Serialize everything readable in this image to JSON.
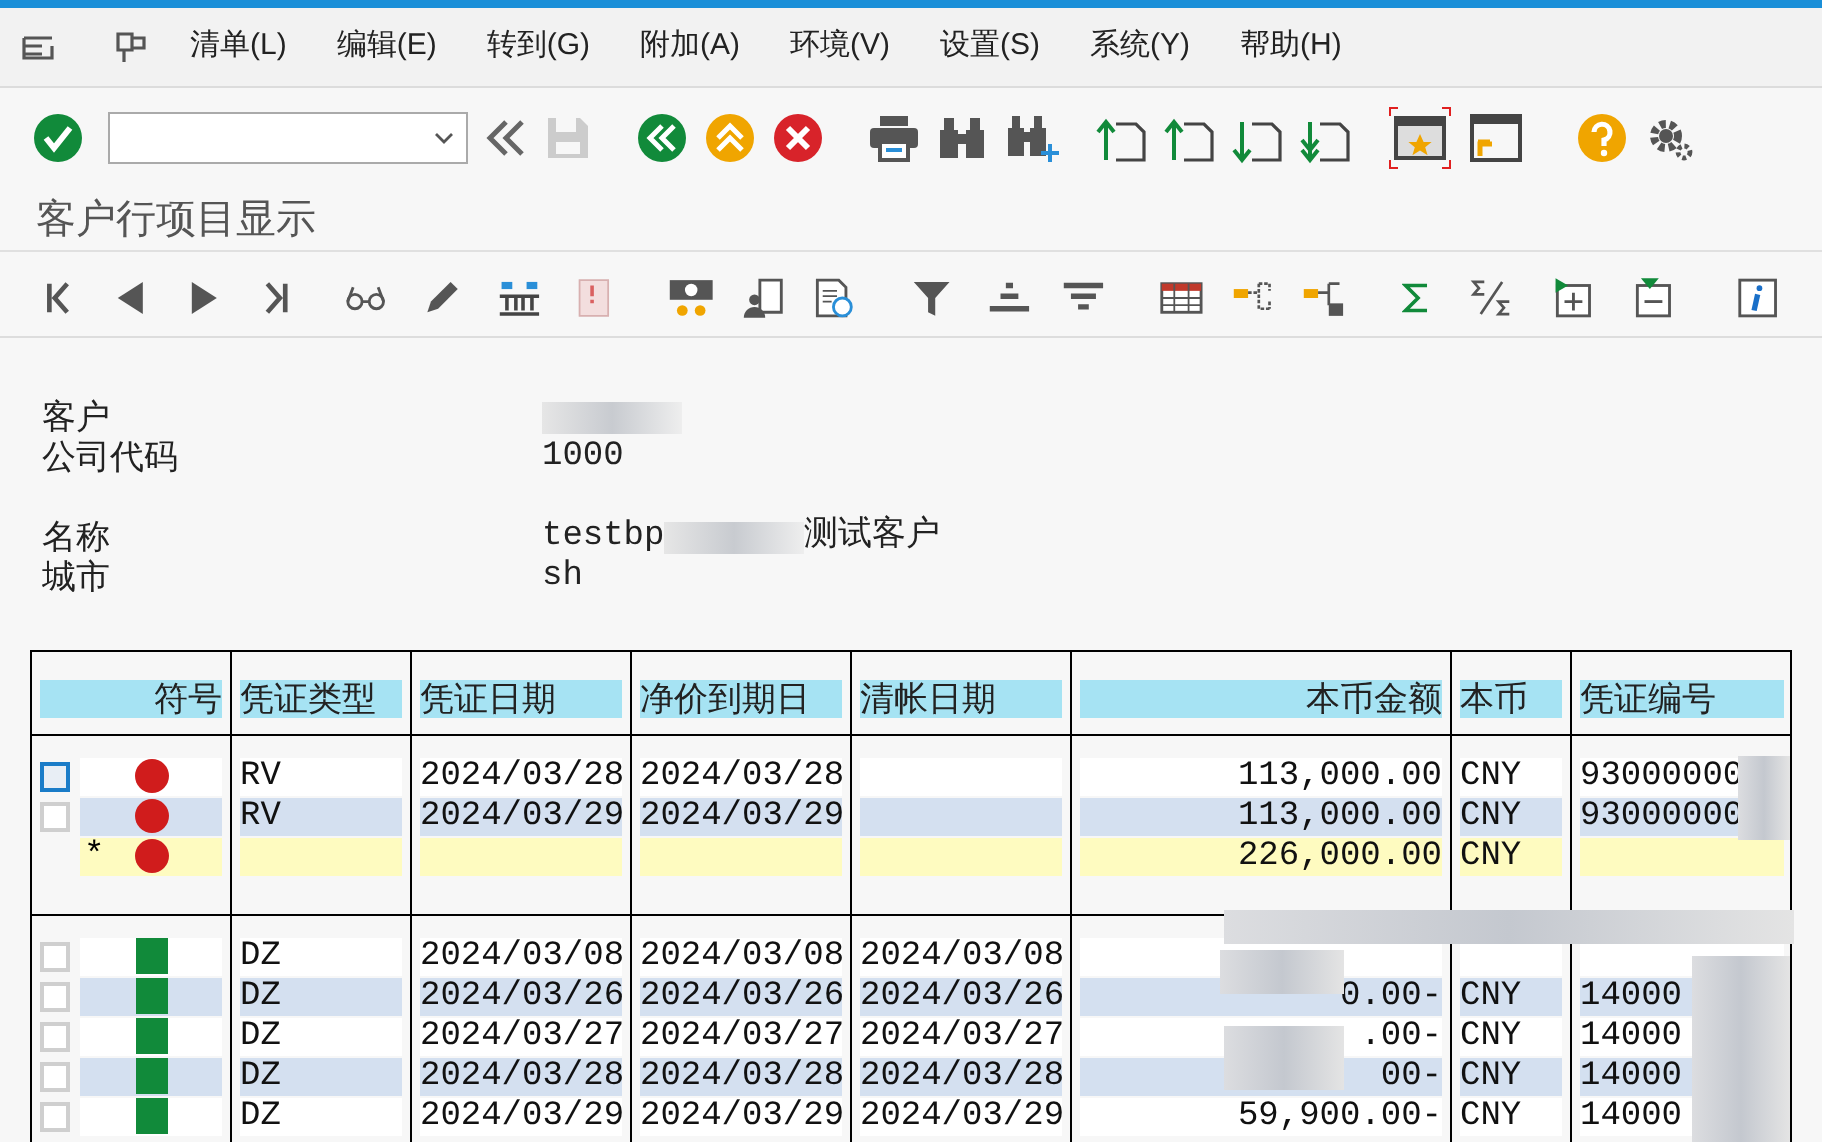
{
  "menu": [
    {
      "label": "清单(L)"
    },
    {
      "label": "编辑(E)"
    },
    {
      "label": "转到(G)"
    },
    {
      "label": "附加(A)"
    },
    {
      "label": "环境(V)"
    },
    {
      "label": "设置(S)"
    },
    {
      "label": "系统(Y)"
    },
    {
      "label": "帮助(H)"
    }
  ],
  "title": "客户行项目显示",
  "header": {
    "fields": [
      {
        "label": "客户",
        "masked": true
      },
      {
        "label": "公司代码",
        "value": "1000"
      },
      {
        "label": "名称",
        "value": "testbp",
        "value_after_mask": "测试客户",
        "masked": true
      },
      {
        "label": "城市",
        "value": "sh"
      }
    ]
  },
  "table": {
    "columns": [
      "符号",
      "凭证类型",
      "凭证日期",
      "净价到期日",
      "清帐日期",
      "本币金额",
      "本币",
      "凭证编号"
    ],
    "groups": [
      {
        "rows": [
          {
            "kind": "open",
            "selected": false,
            "focused": true,
            "doc_type": "RV",
            "doc_date": "2024/03/28",
            "due_date": "2024/03/28",
            "amount": "113,000.00",
            "currency": "CNY",
            "doc_no": "93000000"
          },
          {
            "kind": "open",
            "selected": false,
            "focused": false,
            "doc_type": "RV",
            "doc_date": "2024/03/29",
            "due_date": "2024/03/29",
            "amount": "113,000.00",
            "currency": "CNY",
            "doc_no": "93000000"
          },
          {
            "kind": "total",
            "marker": "*",
            "amount": "226,000.00",
            "currency": "CNY"
          }
        ]
      },
      {
        "rows": [
          {
            "kind": "cleared",
            "selected": false,
            "focused": false,
            "doc_type": "DZ",
            "doc_date": "2024/03/08",
            "due_date": "2024/03/08",
            "clearing_date": "2024/03/08"
          },
          {
            "kind": "cleared",
            "selected": false,
            "focused": false,
            "doc_type": "DZ",
            "doc_date": "2024/03/26",
            "due_date": "2024/03/26",
            "clearing_date": "2024/03/26",
            "amount": "0.00-",
            "currency": "CNY",
            "doc_no": "14000"
          },
          {
            "kind": "cleared",
            "selected": false,
            "focused": false,
            "doc_type": "DZ",
            "doc_date": "2024/03/27",
            "due_date": "2024/03/27",
            "clearing_date": "2024/03/27",
            "amount": ".00-",
            "currency": "CNY",
            "doc_no": "14000"
          },
          {
            "kind": "cleared",
            "selected": false,
            "focused": false,
            "doc_type": "DZ",
            "doc_date": "2024/03/28",
            "due_date": "2024/03/28",
            "clearing_date": "2024/03/28",
            "amount": "00-",
            "currency": "CNY",
            "doc_no": "14000"
          },
          {
            "kind": "cleared",
            "selected": false,
            "focused": false,
            "doc_type": "DZ",
            "doc_date": "2024/03/29",
            "due_date": "2024/03/29",
            "clearing_date": "2024/03/29",
            "amount": "59,900.00-",
            "currency": "CNY",
            "doc_no": "14000"
          }
        ]
      }
    ]
  }
}
